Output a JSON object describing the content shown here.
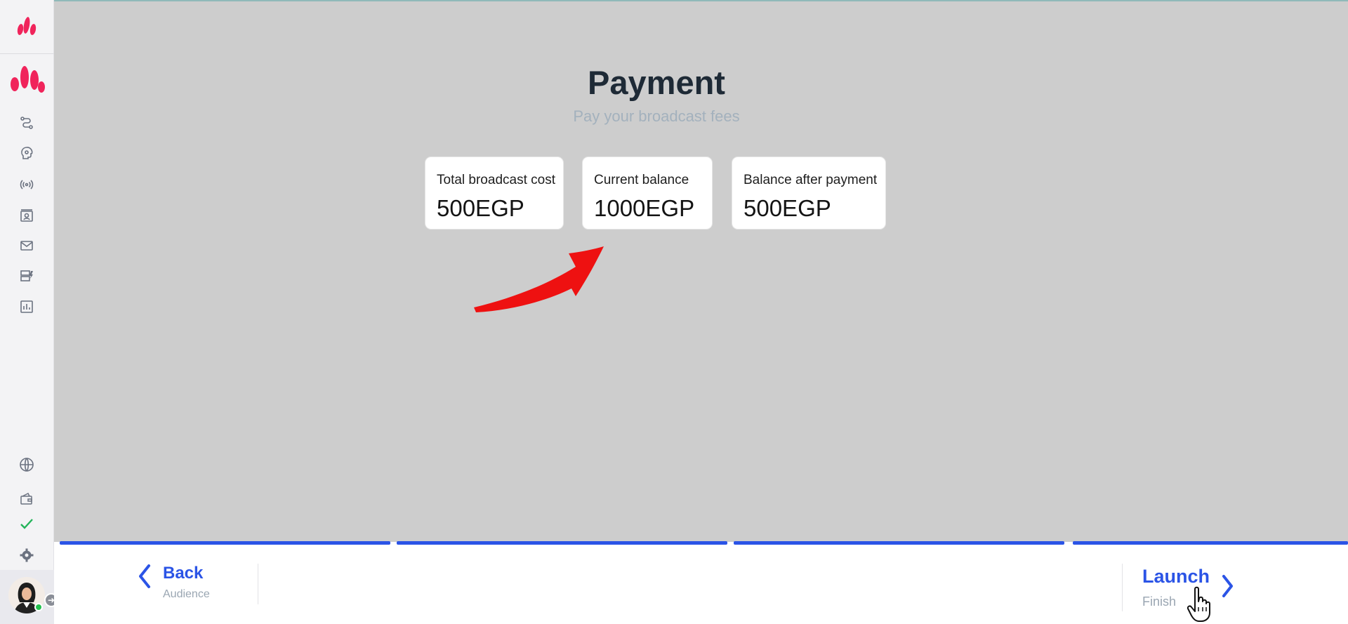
{
  "page": {
    "title": "Payment",
    "subtitle": "Pay your broadcast fees"
  },
  "cards": [
    {
      "label": "Total broadcast cost",
      "value": "500EGP"
    },
    {
      "label": "Current balance",
      "value": "1000EGP"
    },
    {
      "label": "Balance after payment",
      "value": "500EGP"
    }
  ],
  "footer": {
    "back_label": "Back",
    "back_sub": "Audience",
    "launch_label": "Launch",
    "launch_sub": "Finish"
  },
  "sidebar": {
    "icons": [
      "flow-icon",
      "bot-settings-icon",
      "broadcast-icon",
      "contacts-icon",
      "inbox-icon",
      "templates-icon",
      "analytics-icon",
      "globe-icon",
      "wallet-icon",
      "check-icon",
      "settings-icon"
    ]
  },
  "colors": {
    "accent": "#2b54e6",
    "brand": "#f0245b",
    "overlay": "#cdcdcd",
    "online": "#23c14e"
  },
  "progress_steps": 4,
  "progress_completed": 4
}
